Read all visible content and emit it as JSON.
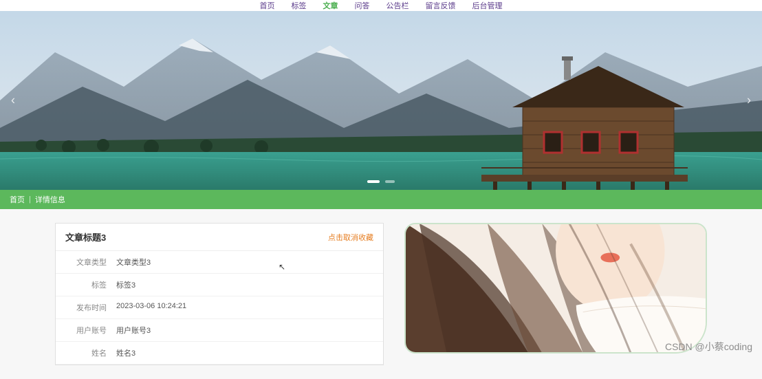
{
  "nav": {
    "items": [
      {
        "label": "首页",
        "active": false
      },
      {
        "label": "标签",
        "active": false
      },
      {
        "label": "文章",
        "active": true
      },
      {
        "label": "问答",
        "active": false
      },
      {
        "label": "公告栏",
        "active": false
      },
      {
        "label": "留言反馈",
        "active": false
      },
      {
        "label": "后台管理",
        "active": false
      }
    ]
  },
  "breadcrumb": {
    "home": "首页",
    "current": "详情信息"
  },
  "panel": {
    "title": "文章标题3",
    "action": "点击取消收藏"
  },
  "details": {
    "rows": [
      {
        "label": "文章类型",
        "value": "文章类型3"
      },
      {
        "label": "标签",
        "value": "标签3"
      },
      {
        "label": "发布时间",
        "value": "2023-03-06 10:24:21"
      },
      {
        "label": "用户账号",
        "value": "用户账号3"
      },
      {
        "label": "姓名",
        "value": "姓名3"
      }
    ]
  },
  "watermark": "CSDN @小蔡coding"
}
